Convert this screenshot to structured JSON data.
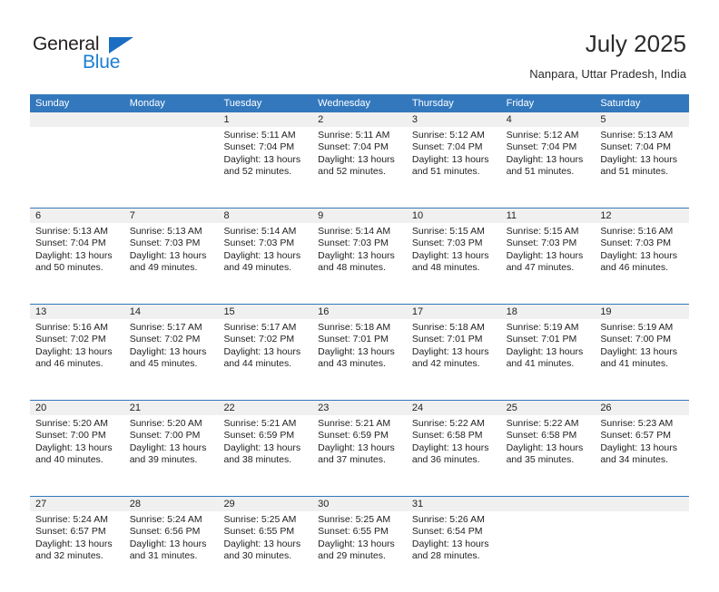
{
  "brand": {
    "name_part1": "General",
    "name_part2": "Blue",
    "triangle_icon": "triangle-icon",
    "accent_color": "#1b7fd4"
  },
  "header": {
    "title": "July 2025",
    "subtitle": "Nanpara, Uttar Pradesh, India"
  },
  "calendar": {
    "header_color": "#3378bd",
    "daynum_band_color": "#f0f0f0",
    "weekdays": [
      "Sunday",
      "Monday",
      "Tuesday",
      "Wednesday",
      "Thursday",
      "Friday",
      "Saturday"
    ],
    "weeks": [
      [
        {
          "day": "",
          "lines": []
        },
        {
          "day": "",
          "lines": []
        },
        {
          "day": "1",
          "lines": [
            "Sunrise: 5:11 AM",
            "Sunset: 7:04 PM",
            "Daylight: 13 hours",
            "and 52 minutes."
          ]
        },
        {
          "day": "2",
          "lines": [
            "Sunrise: 5:11 AM",
            "Sunset: 7:04 PM",
            "Daylight: 13 hours",
            "and 52 minutes."
          ]
        },
        {
          "day": "3",
          "lines": [
            "Sunrise: 5:12 AM",
            "Sunset: 7:04 PM",
            "Daylight: 13 hours",
            "and 51 minutes."
          ]
        },
        {
          "day": "4",
          "lines": [
            "Sunrise: 5:12 AM",
            "Sunset: 7:04 PM",
            "Daylight: 13 hours",
            "and 51 minutes."
          ]
        },
        {
          "day": "5",
          "lines": [
            "Sunrise: 5:13 AM",
            "Sunset: 7:04 PM",
            "Daylight: 13 hours",
            "and 51 minutes."
          ]
        }
      ],
      [
        {
          "day": "6",
          "lines": [
            "Sunrise: 5:13 AM",
            "Sunset: 7:04 PM",
            "Daylight: 13 hours",
            "and 50 minutes."
          ]
        },
        {
          "day": "7",
          "lines": [
            "Sunrise: 5:13 AM",
            "Sunset: 7:03 PM",
            "Daylight: 13 hours",
            "and 49 minutes."
          ]
        },
        {
          "day": "8",
          "lines": [
            "Sunrise: 5:14 AM",
            "Sunset: 7:03 PM",
            "Daylight: 13 hours",
            "and 49 minutes."
          ]
        },
        {
          "day": "9",
          "lines": [
            "Sunrise: 5:14 AM",
            "Sunset: 7:03 PM",
            "Daylight: 13 hours",
            "and 48 minutes."
          ]
        },
        {
          "day": "10",
          "lines": [
            "Sunrise: 5:15 AM",
            "Sunset: 7:03 PM",
            "Daylight: 13 hours",
            "and 48 minutes."
          ]
        },
        {
          "day": "11",
          "lines": [
            "Sunrise: 5:15 AM",
            "Sunset: 7:03 PM",
            "Daylight: 13 hours",
            "and 47 minutes."
          ]
        },
        {
          "day": "12",
          "lines": [
            "Sunrise: 5:16 AM",
            "Sunset: 7:03 PM",
            "Daylight: 13 hours",
            "and 46 minutes."
          ]
        }
      ],
      [
        {
          "day": "13",
          "lines": [
            "Sunrise: 5:16 AM",
            "Sunset: 7:02 PM",
            "Daylight: 13 hours",
            "and 46 minutes."
          ]
        },
        {
          "day": "14",
          "lines": [
            "Sunrise: 5:17 AM",
            "Sunset: 7:02 PM",
            "Daylight: 13 hours",
            "and 45 minutes."
          ]
        },
        {
          "day": "15",
          "lines": [
            "Sunrise: 5:17 AM",
            "Sunset: 7:02 PM",
            "Daylight: 13 hours",
            "and 44 minutes."
          ]
        },
        {
          "day": "16",
          "lines": [
            "Sunrise: 5:18 AM",
            "Sunset: 7:01 PM",
            "Daylight: 13 hours",
            "and 43 minutes."
          ]
        },
        {
          "day": "17",
          "lines": [
            "Sunrise: 5:18 AM",
            "Sunset: 7:01 PM",
            "Daylight: 13 hours",
            "and 42 minutes."
          ]
        },
        {
          "day": "18",
          "lines": [
            "Sunrise: 5:19 AM",
            "Sunset: 7:01 PM",
            "Daylight: 13 hours",
            "and 41 minutes."
          ]
        },
        {
          "day": "19",
          "lines": [
            "Sunrise: 5:19 AM",
            "Sunset: 7:00 PM",
            "Daylight: 13 hours",
            "and 41 minutes."
          ]
        }
      ],
      [
        {
          "day": "20",
          "lines": [
            "Sunrise: 5:20 AM",
            "Sunset: 7:00 PM",
            "Daylight: 13 hours",
            "and 40 minutes."
          ]
        },
        {
          "day": "21",
          "lines": [
            "Sunrise: 5:20 AM",
            "Sunset: 7:00 PM",
            "Daylight: 13 hours",
            "and 39 minutes."
          ]
        },
        {
          "day": "22",
          "lines": [
            "Sunrise: 5:21 AM",
            "Sunset: 6:59 PM",
            "Daylight: 13 hours",
            "and 38 minutes."
          ]
        },
        {
          "day": "23",
          "lines": [
            "Sunrise: 5:21 AM",
            "Sunset: 6:59 PM",
            "Daylight: 13 hours",
            "and 37 minutes."
          ]
        },
        {
          "day": "24",
          "lines": [
            "Sunrise: 5:22 AM",
            "Sunset: 6:58 PM",
            "Daylight: 13 hours",
            "and 36 minutes."
          ]
        },
        {
          "day": "25",
          "lines": [
            "Sunrise: 5:22 AM",
            "Sunset: 6:58 PM",
            "Daylight: 13 hours",
            "and 35 minutes."
          ]
        },
        {
          "day": "26",
          "lines": [
            "Sunrise: 5:23 AM",
            "Sunset: 6:57 PM",
            "Daylight: 13 hours",
            "and 34 minutes."
          ]
        }
      ],
      [
        {
          "day": "27",
          "lines": [
            "Sunrise: 5:24 AM",
            "Sunset: 6:57 PM",
            "Daylight: 13 hours",
            "and 32 minutes."
          ]
        },
        {
          "day": "28",
          "lines": [
            "Sunrise: 5:24 AM",
            "Sunset: 6:56 PM",
            "Daylight: 13 hours",
            "and 31 minutes."
          ]
        },
        {
          "day": "29",
          "lines": [
            "Sunrise: 5:25 AM",
            "Sunset: 6:55 PM",
            "Daylight: 13 hours",
            "and 30 minutes."
          ]
        },
        {
          "day": "30",
          "lines": [
            "Sunrise: 5:25 AM",
            "Sunset: 6:55 PM",
            "Daylight: 13 hours",
            "and 29 minutes."
          ]
        },
        {
          "day": "31",
          "lines": [
            "Sunrise: 5:26 AM",
            "Sunset: 6:54 PM",
            "Daylight: 13 hours",
            "and 28 minutes."
          ]
        },
        {
          "day": "",
          "lines": []
        },
        {
          "day": "",
          "lines": []
        }
      ]
    ]
  }
}
